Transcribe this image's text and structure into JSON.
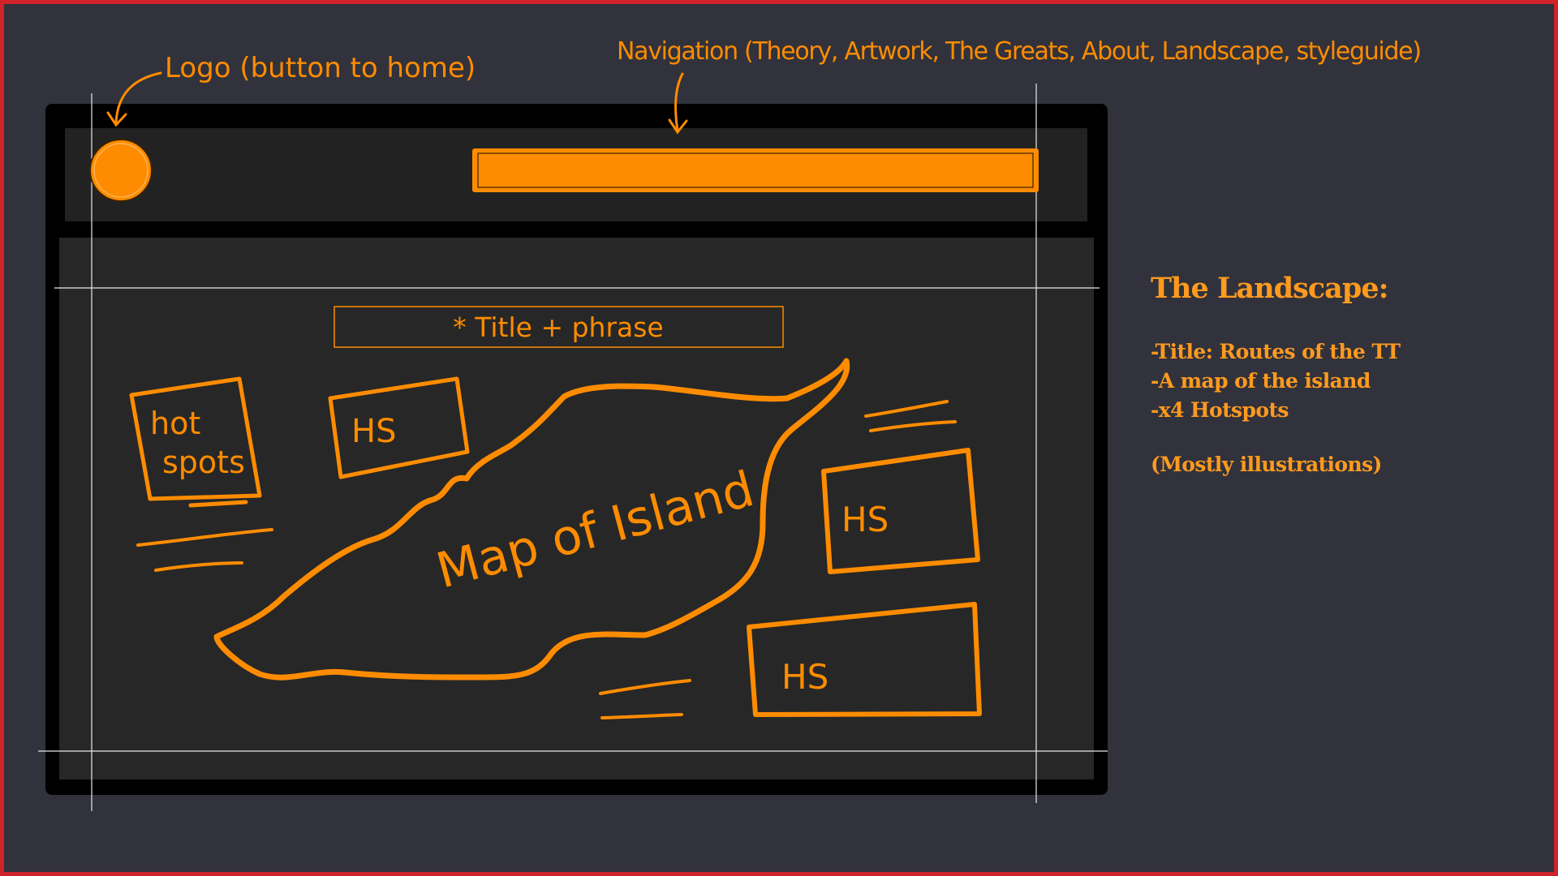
{
  "annotations": {
    "logo": "Logo (button to home)",
    "navigation": "Navigation (Theory, Artwork, The Greats, About, Landscape, styleguide)"
  },
  "wireframe": {
    "title_box": "* Title + phrase",
    "hotspots_label_line1": "hot",
    "hotspots_label_line2": "spots",
    "hotspot_1": "HS",
    "hotspot_2": "HS",
    "hotspot_3": "HS",
    "map_label": "Map of Island"
  },
  "notes": {
    "title": "The Landscape:",
    "items": [
      "-Title: Routes of the TT",
      "-A map of the island",
      "-x4 Hotspots"
    ],
    "aside": "(Mostly illustrations)"
  },
  "colors": {
    "background": "#31323b",
    "frame": "#000000",
    "panel": "#262626",
    "accent": "#ff8c00",
    "border": "#d0222a"
  }
}
